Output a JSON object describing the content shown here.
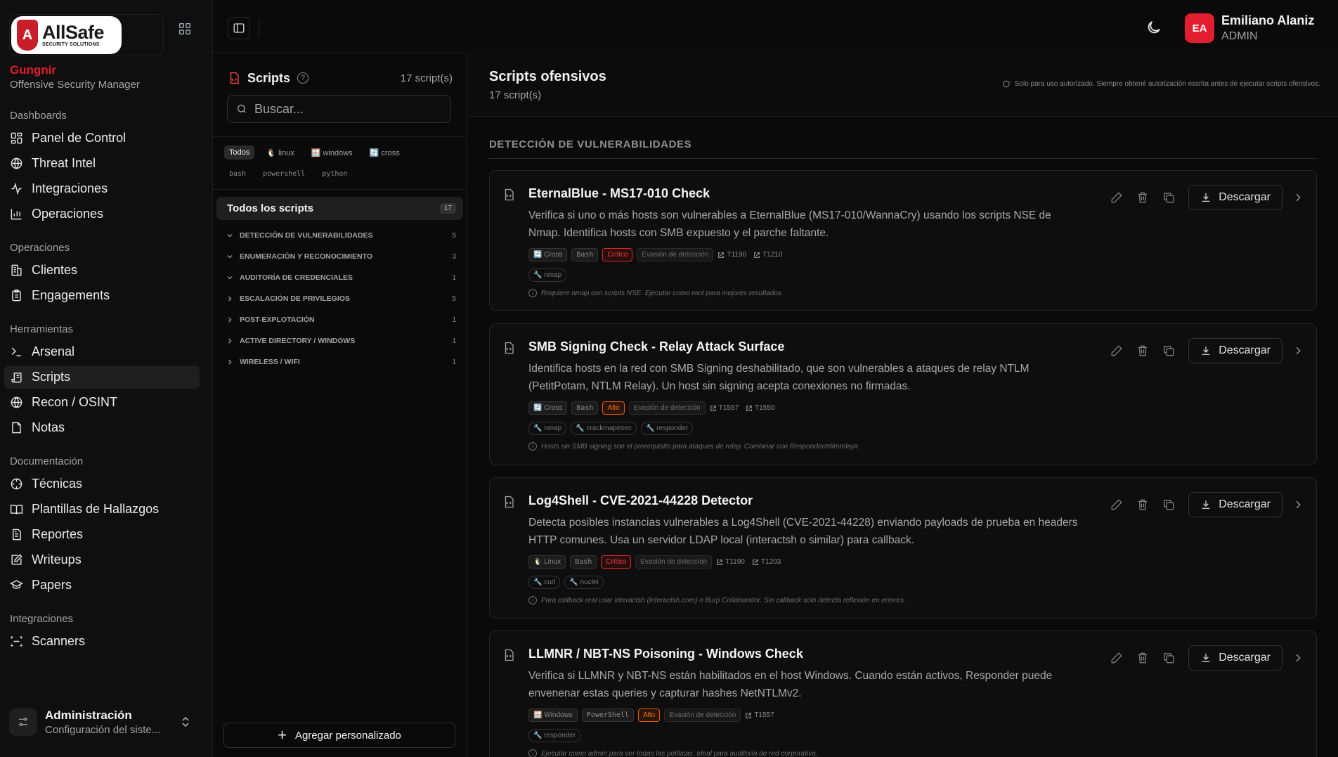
{
  "brand": {
    "logo_big": "AllSafe",
    "logo_small": "SECURITY SOLUTIONS",
    "logo_letter": "A",
    "name": "Gungnir",
    "subtitle": "Offensive Security Manager"
  },
  "nav": {
    "groups": [
      {
        "label": "Dashboards",
        "items": [
          "Panel de Control",
          "Threat Intel",
          "Integraciones",
          "Operaciones"
        ]
      },
      {
        "label": "Operaciones",
        "items": [
          "Clientes",
          "Engagements"
        ]
      },
      {
        "label": "Herramientas",
        "items": [
          "Arsenal",
          "Scripts",
          "Recon / OSINT",
          "Notas"
        ]
      },
      {
        "label": "Documentación",
        "items": [
          "Técnicas",
          "Plantillas de Hallazgos",
          "Reportes",
          "Writeups",
          "Papers"
        ]
      },
      {
        "label": "Integraciones",
        "items": [
          "Scanners"
        ]
      }
    ],
    "active": "Scripts"
  },
  "admin": {
    "title": "Administración",
    "subtitle": "Configuración del siste..."
  },
  "user": {
    "initials": "EA",
    "name": "Emiliano Alaniz",
    "role": "ADMIN"
  },
  "panel": {
    "title": "Scripts",
    "count": "17 script(s)",
    "search_placeholder": "Buscar...",
    "filters_os": [
      "Todos",
      "🐧 linux",
      "🪟 windows",
      "🔄 cross"
    ],
    "filters_lang": [
      "bash",
      "powershell",
      "python"
    ],
    "all_label": "Todos los scripts",
    "all_count": "17",
    "categories": [
      {
        "label": "DETECCIÓN DE VULNERABILIDADES",
        "count": "5",
        "open": true
      },
      {
        "label": "ENUMERACIÓN Y RECONOCIMIENTO",
        "count": "3",
        "open": true
      },
      {
        "label": "AUDITORÍA DE CREDENCIALES",
        "count": "1",
        "open": true
      },
      {
        "label": "ESCALACIÓN DE PRIVILEGIOS",
        "count": "5",
        "open": false
      },
      {
        "label": "POST-EXPLOTACIÓN",
        "count": "1",
        "open": false
      },
      {
        "label": "ACTIVE DIRECTORY / WINDOWS",
        "count": "1",
        "open": false
      },
      {
        "label": "WIRELESS / WIFI",
        "count": "1",
        "open": false
      }
    ],
    "add_label": "Agregar personalizado"
  },
  "content": {
    "title": "Scripts ofensivos",
    "subtitle": "17 script(s)",
    "notice": "Solo para uso autorizado. Siempre obtené autorización escrita antes de ejecutar scripts ofensivos.",
    "section": "DETECCIÓN DE VULNERABILIDADES",
    "download_label": "Descargar",
    "cards": [
      {
        "title": "EternalBlue - MS17-010 Check",
        "desc": "Verifica si uno o más hosts son vulnerables a EternalBlue (MS17-010/WannaCry) usando los scripts NSE de Nmap. Identifica hosts con SMB expuesto y el parche faltante.",
        "os": "🔄 Cross",
        "lang": "Bash",
        "severity": "Crítico",
        "sev_class": "crit",
        "evasion": "Evasión de detección",
        "techniques": [
          "T1190",
          "T1210"
        ],
        "tools": [
          "🔧 nmap"
        ],
        "note": "Requiere nmap con scripts NSE. Ejecutar como root para mejores resultados."
      },
      {
        "title": "SMB Signing Check - Relay Attack Surface",
        "desc": "Identifica hosts en la red con SMB Signing deshabilitado, que son vulnerables a ataques de relay NTLM (PetitPotam, NTLM Relay). Un host sin signing acepta conexiones no firmadas.",
        "os": "🔄 Cross",
        "lang": "Bash",
        "severity": "Alto",
        "sev_class": "alto",
        "evasion": "Evasión de detección",
        "techniques": [
          "T1557",
          "T1550"
        ],
        "tools": [
          "🔧 nmap",
          "🔧 crackmapexec",
          "🔧 responder"
        ],
        "note": "Hosts sin SMB signing son el prerequisito para ataques de relay. Combinar con Responder/ntlmrelayx."
      },
      {
        "title": "Log4Shell - CVE-2021-44228 Detector",
        "desc": "Detecta posibles instancias vulnerables a Log4Shell (CVE-2021-44228) enviando payloads de prueba en headers HTTP comunes. Usa un servidor LDAP local (interactsh o similar) para callback.",
        "os": "🐧 Linux",
        "lang": "Bash",
        "severity": "Crítico",
        "sev_class": "crit",
        "evasion": "Evasión de detección",
        "techniques": [
          "T1190",
          "T1203"
        ],
        "tools": [
          "🔧 curl",
          "🔧 nuclei"
        ],
        "note": "Para callback real usar interactsh (interactsh.com) o Burp Collaborator. Sin callback solo detecta reflexión en errores."
      },
      {
        "title": "LLMNR / NBT-NS Poisoning - Windows Check",
        "desc": "Verifica si LLMNR y NBT-NS están habilitados en el host Windows. Cuando están activos, Responder puede envenenar estas queries y capturar hashes NetNTLMv2.",
        "os": "🪟 Windows",
        "lang": "PowerShell",
        "severity": "Alto",
        "sev_class": "alto",
        "evasion": "Evasión de detección",
        "techniques": [
          "T1557"
        ],
        "tools": [
          "🔧 responder"
        ],
        "note": "Ejecutar como admin para ver todas las políticas. Ideal para auditoría de red corporativa."
      }
    ]
  }
}
